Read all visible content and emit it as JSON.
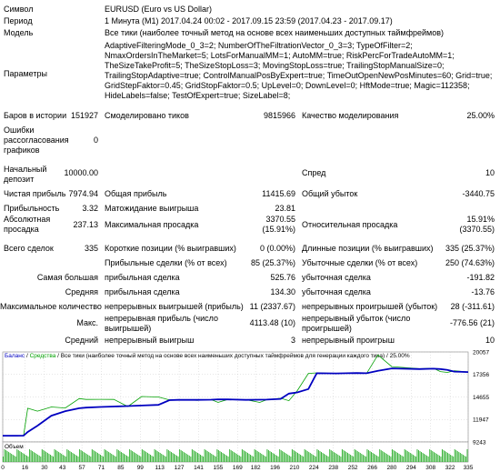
{
  "report": {
    "symbol_label": "Символ",
    "symbol_value": "EURUSD (Euro vs US Dollar)",
    "period_label": "Период",
    "period_value": "1 Минута (M1) 2017.04.24 00:02 - 2017.09.15 23:59 (2017.04.23 - 2017.09.17)",
    "model_label": "Модель",
    "model_value": "Все тики (наиболее точный метод на основе всех наименьших доступных таймфреймов)",
    "params_label": "Параметры",
    "params_lines": [
      "AdaptiveFilteringMode_0_3=2; NumberOfTheFiltrationVector_0_3=3; TypeOfFilter=2;",
      "NmaxOrdersInTheMarket=5; LotsForManualMM=1; AutoMM=true; RiskPercForTradeAutoMM=1;",
      "TheSizeTakeProfit=5; TheSizeStopLoss=3; MovingStopLoss=true; TrailingStopManualSize=0;",
      "TrailingStopAdaptive=true; ControlManualPosByExpert=true; TimeOutOpenNewPosMinutes=60; Grid=true;",
      "GridStepFaktor=0.45; GridStopFaktor=0.5; UpLevel=0; DownLevel=0; HftMode=true; Magic=112358;",
      "HideLabels=false; TestOfExpert=true; SizeLabel=8;"
    ],
    "bars_label": "Баров в истории",
    "bars_value": "151927",
    "ticks_label": "Смоделировано тиков",
    "ticks_value": "9815966",
    "quality_label": "Качество моделирования",
    "quality_value": "25.00%",
    "errors_label": "Ошибки рассогласования графиков",
    "errors_value": "0",
    "deposit_label": "Начальный депозит",
    "deposit_value": "10000.00",
    "spread_label": "Спред",
    "spread_value": "10",
    "net_profit_label": "Чистая прибыль",
    "net_profit_value": "7974.94",
    "gross_profit_label": "Общая прибыль",
    "gross_profit_value": "11415.69",
    "gross_loss_label": "Общий убыток",
    "gross_loss_value": "-3440.75",
    "pf_label": "Прибыльность",
    "pf_value": "3.32",
    "expected_label": "Матожидание выигрыша",
    "expected_value": "23.81",
    "abs_dd_label": "Абсолютная просадка",
    "abs_dd_value": "237.13",
    "max_dd_label": "Максимальная просадка",
    "max_dd_value1": "3370.55",
    "max_dd_value2": "(15.91%)",
    "rel_dd_label": "Относительная просадка",
    "rel_dd_value1": "15.91%",
    "rel_dd_value2": "(3370.55)",
    "trades_label": "Всего сделок",
    "trades_value": "335",
    "short_label": "Короткие позиции (% выигравших)",
    "short_value": "0 (0.00%)",
    "long_label": "Длинные позиции (% выигравших)",
    "long_value": "335 (25.37%)",
    "profit_trades_label": "Прибыльные сделки (% от всех)",
    "profit_trades_value": "85 (25.37%)",
    "loss_trades_label": "Убыточные сделки (% от всех)",
    "loss_trades_value": "250 (74.63%)",
    "largest_label": "Самая большая",
    "largest_profit_label": "прибыльная сделка",
    "largest_profit_value": "525.76",
    "largest_loss_label": "убыточная сделка",
    "largest_loss_value": "-191.82",
    "average_label": "Средняя",
    "avg_profit_label": "прибыльная сделка",
    "avg_profit_value": "134.30",
    "avg_loss_label": "убыточная сделка",
    "avg_loss_value": "-13.76",
    "max_count_label": "Максимальное количество",
    "cons_wins_label": "непрерывных выигрышей (прибыль)",
    "cons_wins_value": "11 (2337.67)",
    "cons_losses_label": "непрерывных проигрышей (убыток)",
    "cons_losses_value": "28 (-311.61)",
    "max_label": "Макс.",
    "cons_profit_label": "непрерывная прибыль (число выигрышей)",
    "cons_profit_value": "4113.48 (10)",
    "cons_loss_label": "непрерывный убыток (число проигрышей)",
    "cons_loss_value": "-776.56 (21)",
    "avg2_label": "Средний",
    "avg_wins_label": "непрерывный выигрыш",
    "avg_wins_value": "3",
    "avg_losses_label": "непрерывный проигрыш",
    "avg_losses_value": "10"
  },
  "chart_data": {
    "type": "line",
    "legend_balance": "Баланс",
    "legend_sep1": " / ",
    "legend_equity": "Средства",
    "legend_rest": " / Все тики (наиболее точный метод на основе всех наименьших доступных таймфреймов для генерации каждого тика) / 25.00%",
    "volume_label": "Объем",
    "colors": {
      "balance": "#0000c0",
      "equity": "#00a000",
      "volume": "#3cb43c",
      "grid": "#c0c0c0"
    },
    "ylim": [
      9243,
      20057
    ],
    "y_ticks": [
      "20057",
      "17356",
      "14655",
      "11947",
      "9243"
    ],
    "x_ticks": [
      "0",
      "16",
      "30",
      "43",
      "57",
      "71",
      "85",
      "99",
      "113",
      "127",
      "141",
      "155",
      "169",
      "182",
      "196",
      "210",
      "224",
      "238",
      "252",
      "266",
      "280",
      "294",
      "308",
      "322",
      "335"
    ],
    "x": [
      0,
      10,
      15,
      18,
      25,
      35,
      45,
      55,
      60,
      70,
      80,
      90,
      100,
      112,
      120,
      126,
      140,
      150,
      155,
      162,
      175,
      185,
      190,
      200,
      206,
      212,
      220,
      226,
      240,
      255,
      262,
      270,
      280,
      300,
      310,
      315,
      320,
      325,
      335
    ],
    "balance": [
      10000,
      10000,
      10010,
      10450,
      11200,
      12400,
      12950,
      13300,
      13370,
      13450,
      13500,
      13560,
      13620,
      13700,
      14270,
      14300,
      14300,
      14320,
      14370,
      14350,
      14300,
      14320,
      14330,
      14420,
      15050,
      15200,
      15600,
      17500,
      17480,
      17520,
      17500,
      17800,
      18080,
      18000,
      18050,
      18000,
      17900,
      17700,
      17640
    ],
    "equity": [
      10000,
      10000,
      10000,
      13300,
      12950,
      13450,
      13330,
      14450,
      14350,
      14370,
      14350,
      13500,
      14700,
      14650,
      14300,
      14330,
      14250,
      14330,
      14000,
      14350,
      14320,
      14000,
      14320,
      14500,
      14200,
      15400,
      17480,
      17540,
      17480,
      17500,
      17500,
      19700,
      18300,
      18050,
      18100,
      17700,
      17600,
      17800,
      17650
    ]
  }
}
